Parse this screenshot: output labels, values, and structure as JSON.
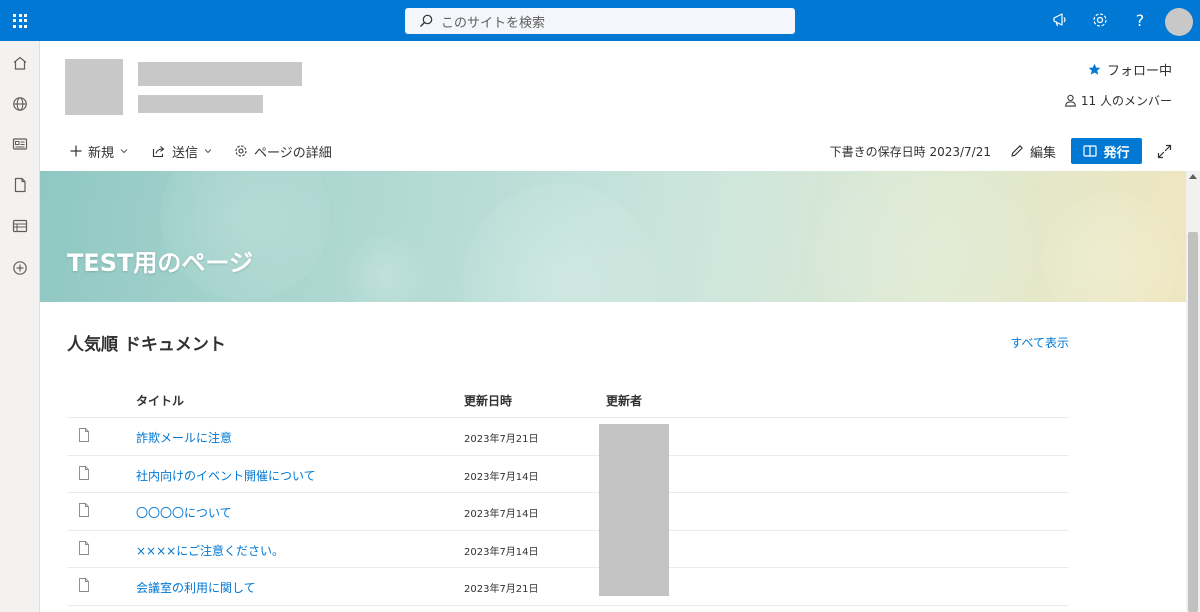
{
  "search": {
    "placeholder": "このサイトを検索"
  },
  "header": {
    "follow_label": "フォロー中",
    "members_label": "11 人のメンバー"
  },
  "commandbar": {
    "new_label": "新規",
    "send_label": "送信",
    "details_label": "ページの詳細",
    "draft_status": "下書きの保存日時 2023/7/21",
    "edit_label": "編集",
    "publish_label": "発行"
  },
  "hero": {
    "title": "TEST用のページ"
  },
  "documents": {
    "section_title": "人気順 ドキュメント",
    "see_all_label": "すべて表示",
    "columns": {
      "title": "タイトル",
      "modified": "更新日時",
      "modified_by": "更新者"
    },
    "rows": [
      {
        "title": "詐欺メールに注意",
        "modified": "2023年7月21日"
      },
      {
        "title": "社内向けのイベント開催について",
        "modified": "2023年7月14日"
      },
      {
        "title": "〇〇〇〇について",
        "modified": "2023年7月14日"
      },
      {
        "title": "××××にご注意ください。",
        "modified": "2023年7月14日"
      },
      {
        "title": "会議室の利用に関して",
        "modified": "2023年7月21日"
      }
    ]
  },
  "colors": {
    "brand": "#0078d4",
    "rail": "#f3f2f1",
    "placeholder_gray": "#c8c8c8"
  }
}
